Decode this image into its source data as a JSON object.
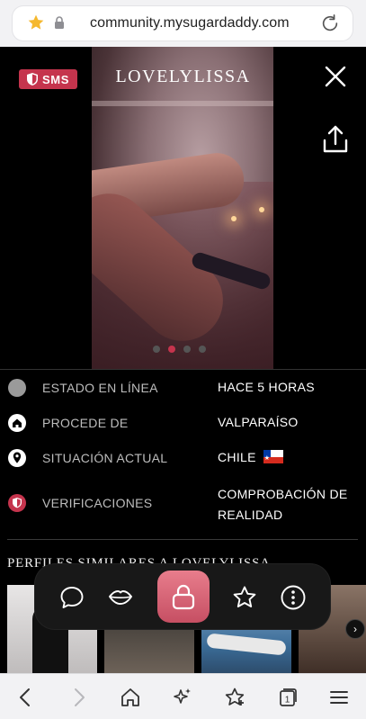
{
  "browser": {
    "url": "community.mysugardaddy.com",
    "tab_count": "1"
  },
  "profile": {
    "name": "LOVELYLISSA",
    "badge": "SMS",
    "carousel": {
      "count": 4,
      "active_index": 1
    }
  },
  "info_rows": [
    {
      "label": "ESTADO EN LÍNEA",
      "value": "HACE 5 HORAS",
      "icon": "status-dot-icon"
    },
    {
      "label": "PROCEDE DE",
      "value": "VALPARAÍSO",
      "icon": "home-icon"
    },
    {
      "label": "SITUACIÓN ACTUAL",
      "value": "CHILE",
      "icon": "location-pin-icon"
    },
    {
      "label": "VERIFICACIONES",
      "value": "COMPROBACIÓN DE REALIDAD",
      "icon": "shield-icon"
    }
  ],
  "similar": {
    "title": "PERFILES SIMILARES A LOVELYLISSA"
  },
  "action_bar": {
    "items": [
      "chat-icon",
      "kiss-icon",
      "lock-icon",
      "star-icon",
      "more-icon"
    ]
  },
  "colors": {
    "accent": "#c5344d",
    "accent_light": "#e87d8c",
    "background": "#000000"
  }
}
